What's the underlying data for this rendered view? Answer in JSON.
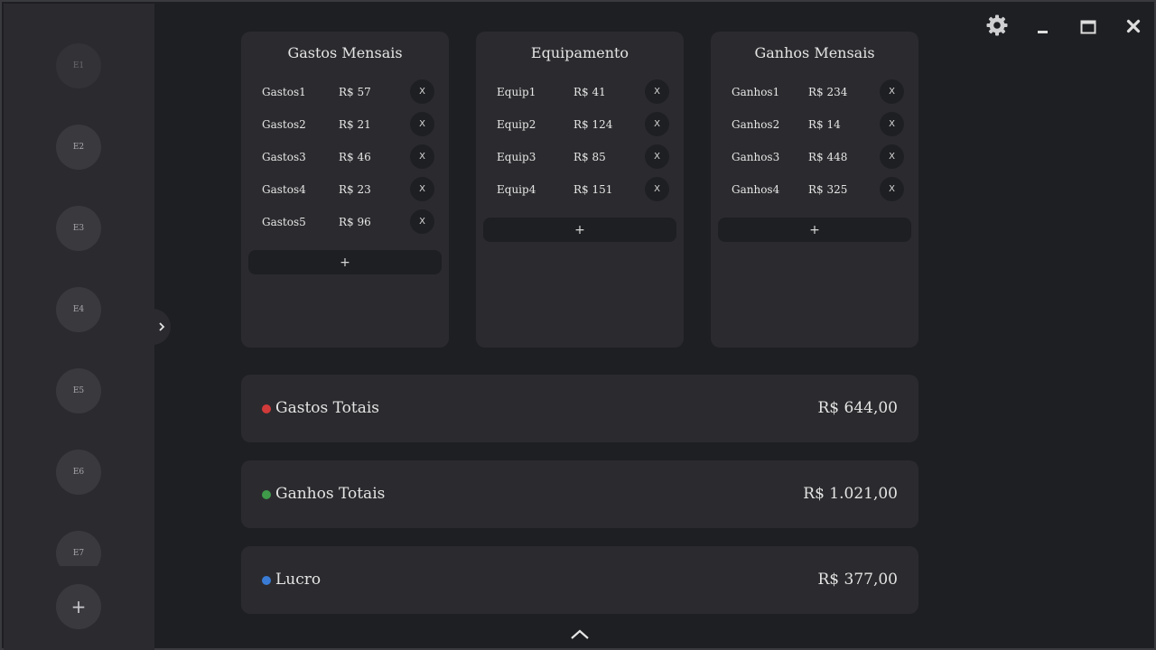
{
  "sidebar": {
    "items": [
      {
        "label": "E1"
      },
      {
        "label": "E2"
      },
      {
        "label": "E3"
      },
      {
        "label": "E4"
      },
      {
        "label": "E5"
      },
      {
        "label": "E6"
      },
      {
        "label": "E7"
      }
    ],
    "add_label": "+"
  },
  "panels": [
    {
      "title": "Gastos Mensais",
      "rows": [
        {
          "name": "Gastos1",
          "value": "R$ 57"
        },
        {
          "name": "Gastos2",
          "value": "R$ 21"
        },
        {
          "name": "Gastos3",
          "value": "R$ 46"
        },
        {
          "name": "Gastos4",
          "value": "R$ 23"
        },
        {
          "name": "Gastos5",
          "value": "R$ 96"
        }
      ],
      "delete_label": "X",
      "add_label": "+"
    },
    {
      "title": "Equipamento",
      "rows": [
        {
          "name": "Equip1",
          "value": "R$ 41"
        },
        {
          "name": "Equip2",
          "value": "R$ 124"
        },
        {
          "name": "Equip3",
          "value": "R$ 85"
        },
        {
          "name": "Equip4",
          "value": "R$ 151"
        }
      ],
      "delete_label": "X",
      "add_label": "+"
    },
    {
      "title": "Ganhos Mensais",
      "rows": [
        {
          "name": "Ganhos1",
          "value": "R$ 234"
        },
        {
          "name": "Ganhos2",
          "value": "R$ 14"
        },
        {
          "name": "Ganhos3",
          "value": "R$ 448"
        },
        {
          "name": "Ganhos4",
          "value": "R$ 325"
        }
      ],
      "delete_label": "X",
      "add_label": "+"
    }
  ],
  "summary": [
    {
      "label": "Gastos Totais",
      "amount": "R$ 644,00",
      "color": "#d13a3a"
    },
    {
      "label": "Ganhos Totais",
      "amount": "R$ 1.021,00",
      "color": "#3f9a4a"
    },
    {
      "label": "Lucro",
      "amount": "R$ 377,00",
      "color": "#3a7bd5"
    }
  ],
  "icons": {
    "settings": "gear-icon",
    "minimize": "minimize-icon",
    "maximize": "maximize-icon",
    "close": "close-icon",
    "sidebar_toggle": "chevron-right-icon",
    "scroll_up": "chevron-up-icon"
  }
}
